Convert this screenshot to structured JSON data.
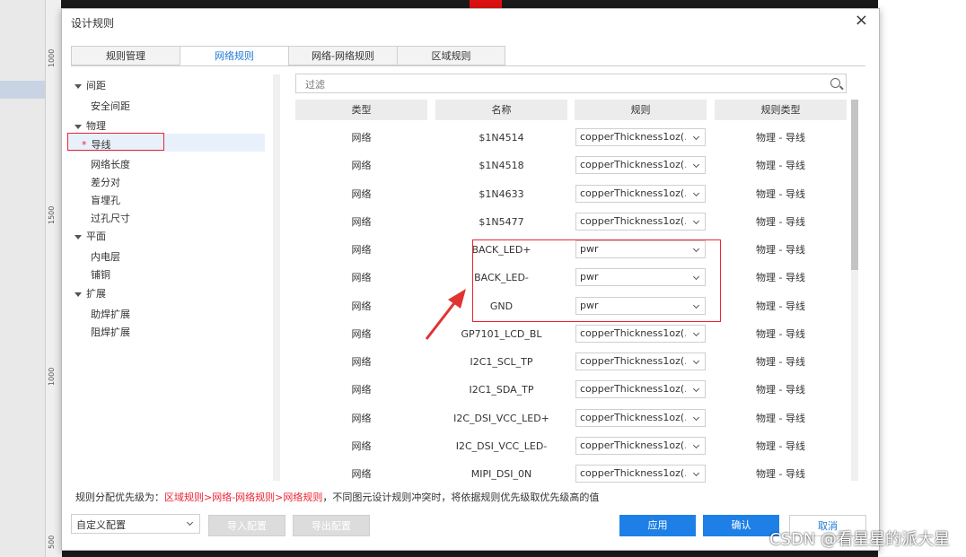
{
  "dialog": {
    "title": "设计规则",
    "close": "×"
  },
  "ruler": [
    "1000",
    "1500",
    "1000",
    "500"
  ],
  "tabs": [
    {
      "label": "规则管理",
      "active": false
    },
    {
      "label": "网络规则",
      "active": true
    },
    {
      "label": "网络-网络规则",
      "active": false
    },
    {
      "label": "区域规则",
      "active": false
    }
  ],
  "tree": {
    "spacing": "间距",
    "safe_spacing": "安全间距",
    "physical": "物理",
    "trace_star": "*",
    "trace": "导线",
    "net_length": "网络长度",
    "diff_pair": "差分对",
    "blind_via": "盲埋孔",
    "via_size": "过孔尺寸",
    "plane": "平面",
    "inner_layer": "内电层",
    "copper_pour": "铺铜",
    "expansion": "扩展",
    "paste_expansion": "助焊扩展",
    "mask_expansion": "阻焊扩展"
  },
  "filter": {
    "placeholder": "过滤"
  },
  "table": {
    "headers": [
      "类型",
      "名称",
      "规则",
      "规则类型"
    ],
    "rows": [
      {
        "type": "网络",
        "name": "$1N4514",
        "rule": "copperThickness1oz(...",
        "rule_type": "物理 - 导线"
      },
      {
        "type": "网络",
        "name": "$1N4518",
        "rule": "copperThickness1oz(...",
        "rule_type": "物理 - 导线"
      },
      {
        "type": "网络",
        "name": "$1N4633",
        "rule": "copperThickness1oz(...",
        "rule_type": "物理 - 导线"
      },
      {
        "type": "网络",
        "name": "$1N5477",
        "rule": "copperThickness1oz(...",
        "rule_type": "物理 - 导线"
      },
      {
        "type": "网络",
        "name": "BACK_LED+",
        "rule": "pwr",
        "rule_type": "物理 - 导线"
      },
      {
        "type": "网络",
        "name": "BACK_LED-",
        "rule": "pwr",
        "rule_type": "物理 - 导线"
      },
      {
        "type": "网络",
        "name": "GND",
        "rule": "pwr",
        "rule_type": "物理 - 导线"
      },
      {
        "type": "网络",
        "name": "GP7101_LCD_BL",
        "rule": "copperThickness1oz(...",
        "rule_type": "物理 - 导线"
      },
      {
        "type": "网络",
        "name": "I2C1_SCL_TP",
        "rule": "copperThickness1oz(...",
        "rule_type": "物理 - 导线"
      },
      {
        "type": "网络",
        "name": "I2C1_SDA_TP",
        "rule": "copperThickness1oz(...",
        "rule_type": "物理 - 导线"
      },
      {
        "type": "网络",
        "name": "I2C_DSI_VCC_LED+",
        "rule": "copperThickness1oz(...",
        "rule_type": "物理 - 导线"
      },
      {
        "type": "网络",
        "name": "I2C_DSI_VCC_LED-",
        "rule": "copperThickness1oz(...",
        "rule_type": "物理 - 导线"
      },
      {
        "type": "网络",
        "name": "MIPI_DSI_0N",
        "rule": "copperThickness1oz(...",
        "rule_type": "物理 - 导线"
      }
    ]
  },
  "note": {
    "prefix": "规则分配优先级为：",
    "priority": "区域规则>网络-网络规则>网络规则",
    "suffix": "，不同图元设计规则冲突时，将依据规则优先级取优先级高的值"
  },
  "footer": {
    "config_select": "自定义配置",
    "import": "导入配置",
    "export": "导出配置",
    "apply": "应用",
    "ok": "确认",
    "cancel": "取消"
  },
  "watermark": "CSDN @看星星的派大星",
  "colors": {
    "accent": "#1e80e6",
    "highlight": "#e23333"
  }
}
